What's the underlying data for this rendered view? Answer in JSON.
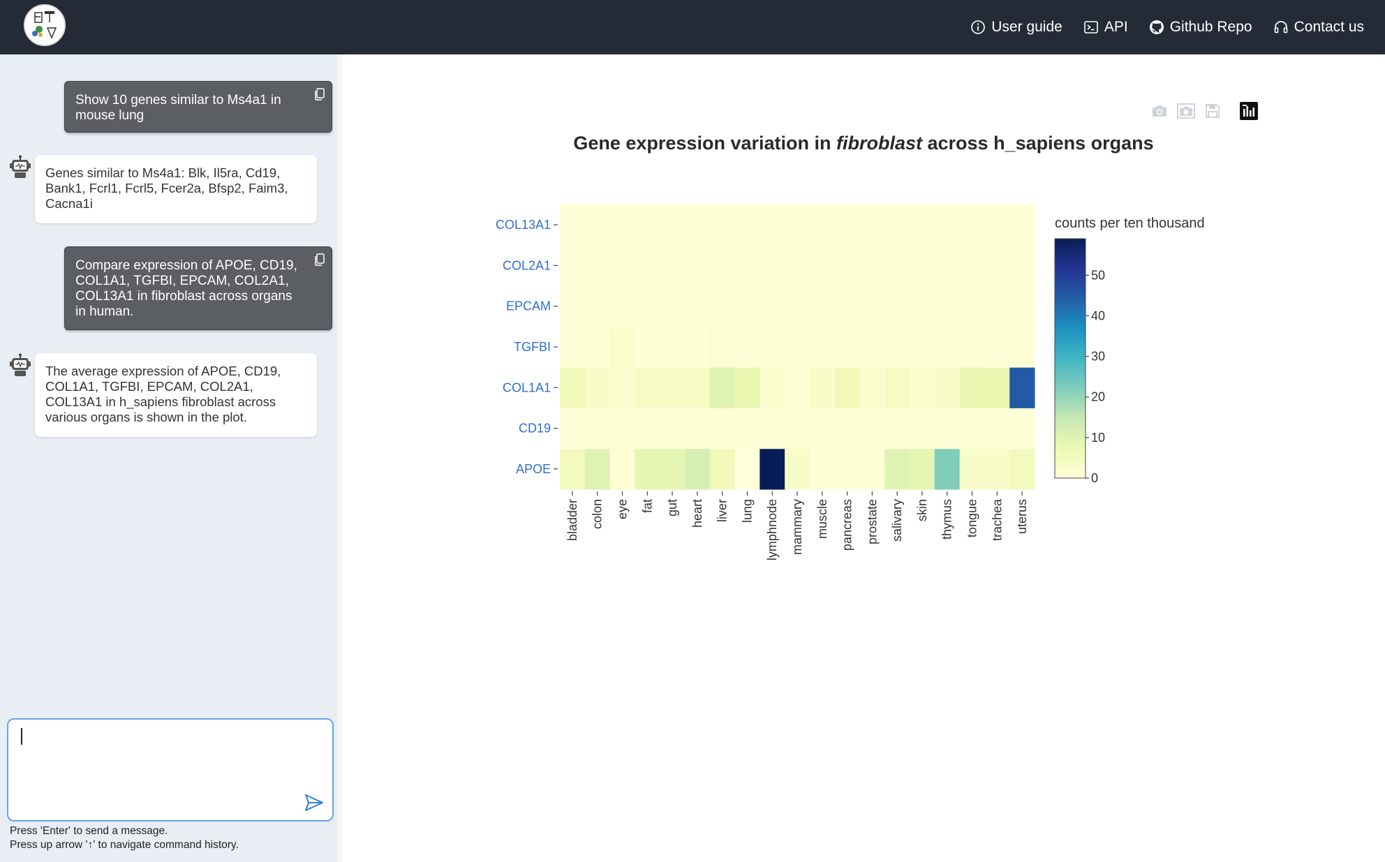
{
  "nav": {
    "links": [
      {
        "label": "User guide",
        "icon": "info-circle-icon"
      },
      {
        "label": "API",
        "icon": "terminal-icon"
      },
      {
        "label": "Github Repo",
        "icon": "github-icon"
      },
      {
        "label": "Contact us",
        "icon": "headset-icon"
      }
    ]
  },
  "chat": {
    "messages": [
      {
        "role": "user",
        "text": "Show 10 genes similar to Ms4a1 in mouse lung"
      },
      {
        "role": "bot",
        "text": "Genes similar to Ms4a1: Blk, Il5ra, Cd19, Bank1, Fcrl1, Fcrl5, Fcer2a, Bfsp2, Faim3, Cacna1i"
      },
      {
        "role": "user",
        "text": "Compare expression of APOE, CD19, COL1A1, TGFBI, EPCAM, COL2A1, COL13A1 in fibroblast across organs in human."
      },
      {
        "role": "bot",
        "text": "The average expression of APOE, CD19, COL1A1, TGFBI, EPCAM, COL2A1, COL13A1 in h_sapiens fibroblast across various organs is shown in the plot."
      }
    ],
    "input_value": "",
    "hint1": "Press 'Enter' to send a message.",
    "hint2": "Press up arrow '↑' to navigate command history."
  },
  "plot": {
    "title_prefix": "Gene expression variation in ",
    "title_italic": "fibroblast",
    "title_suffix": " across h_sapiens organs",
    "modebar": [
      "camera-icon",
      "camera-svg-icon",
      "save-icon",
      "bar-chart-icon"
    ]
  },
  "chart_data": {
    "type": "heatmap",
    "title": "Gene expression variation in fibroblast across h_sapiens organs",
    "colorbar_title": "counts per ten thousand",
    "colorbar_ticks": [
      0,
      10,
      20,
      30,
      40,
      50
    ],
    "zrange": [
      0,
      59
    ],
    "colors": [
      "#ffffd9",
      "#edf8b1",
      "#c7e9b4",
      "#7fcdbb",
      "#41b6c4",
      "#1d91c0",
      "#225ea8",
      "#253494",
      "#081d58"
    ],
    "y_categories": [
      "APOE",
      "CD19",
      "COL1A1",
      "TGFBI",
      "EPCAM",
      "COL2A1",
      "COL13A1"
    ],
    "x_categories": [
      "bladder",
      "colon",
      "eye",
      "fat",
      "gut",
      "heart",
      "liver",
      "lung",
      "lymphnode",
      "mammary",
      "muscle",
      "pancreas",
      "prostate",
      "salivary",
      "skin",
      "thymus",
      "tongue",
      "trachea",
      "uterus"
    ],
    "z": [
      [
        5,
        10,
        1,
        9,
        9,
        12,
        6,
        0,
        59,
        3,
        1,
        1,
        1,
        10,
        9,
        22,
        3,
        3,
        5
      ],
      [
        0.5,
        0.5,
        0.5,
        0.5,
        0.5,
        0.5,
        0.5,
        0.5,
        0.5,
        0.5,
        0.5,
        0.5,
        0.5,
        0.5,
        0.5,
        0.5,
        0.5,
        0.5,
        0.5
      ],
      [
        6,
        3,
        2,
        4,
        4,
        4,
        10,
        8,
        2,
        1,
        3,
        6,
        2,
        4,
        2,
        3,
        8,
        8,
        45
      ],
      [
        0.5,
        0.5,
        2.5,
        0.5,
        0.5,
        0.5,
        1.5,
        0.5,
        0.5,
        0.5,
        1,
        1,
        0.5,
        1,
        0.5,
        0.5,
        1,
        0.5,
        1
      ],
      [
        0.5,
        0.5,
        0.5,
        0.5,
        0.5,
        0.5,
        0.5,
        0.5,
        0.5,
        0.5,
        0.5,
        0.5,
        0.5,
        0.5,
        0.5,
        0.5,
        0.5,
        0.5,
        0.5
      ],
      [
        0.5,
        0.5,
        0.5,
        0.5,
        0.5,
        0.5,
        0.5,
        0.5,
        0.5,
        0.5,
        0.5,
        0.5,
        0.5,
        0.5,
        0.5,
        0.5,
        0.5,
        0.5,
        0.5
      ],
      [
        0.5,
        0.5,
        0.5,
        0.5,
        0.5,
        0.5,
        0.5,
        0.5,
        0.5,
        0.5,
        0.5,
        0.5,
        0.5,
        0.5,
        0.5,
        0.5,
        0.5,
        0.5,
        0.5
      ]
    ]
  }
}
